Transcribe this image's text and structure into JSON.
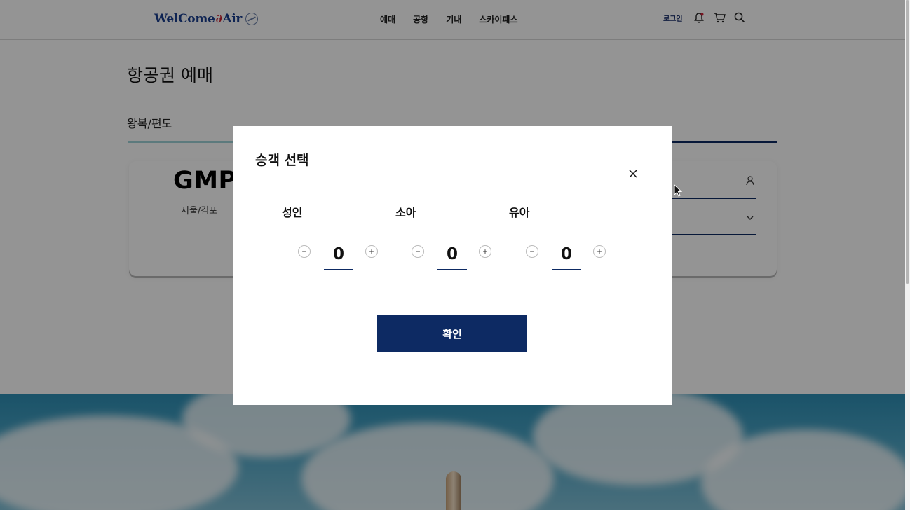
{
  "header": {
    "logo": {
      "text_start": "WelCome",
      "text_end": "Air"
    },
    "nav": [
      "예매",
      "공항",
      "기내",
      "스카이패스"
    ],
    "login_label": "로그인",
    "icons": [
      "bell-icon",
      "cart-icon",
      "search-icon"
    ]
  },
  "page": {
    "title": "항공권 예매",
    "tab_label": "왕복/편도",
    "origin": {
      "code": "GMP",
      "city": "서울/김포"
    }
  },
  "modal": {
    "title": "승객 선택",
    "passengers": [
      {
        "label": "성인",
        "count": "0"
      },
      {
        "label": "소아",
        "count": "0"
      },
      {
        "label": "유아",
        "count": "0"
      }
    ],
    "minus_symbol": "−",
    "plus_symbol": "+",
    "confirm_label": "확인"
  },
  "colors": {
    "brand_navy": "#0d2a63",
    "tab_accent": "#9fd3d8",
    "overlay": "rgba(0,0,0,0.42)"
  }
}
